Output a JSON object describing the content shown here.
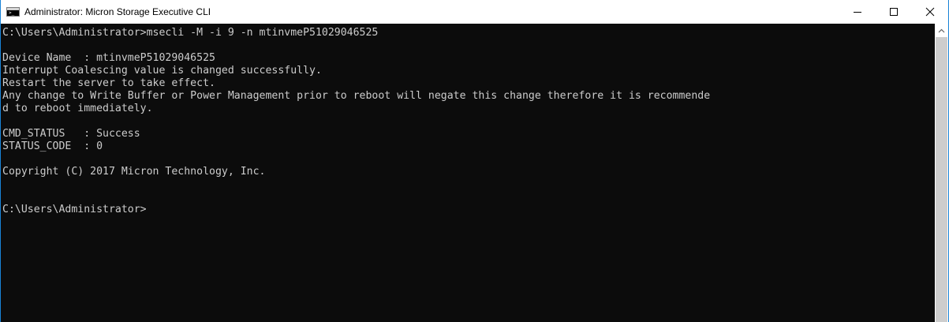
{
  "window": {
    "title": "Administrator: Micron Storage Executive CLI",
    "app_icon_text": ">_"
  },
  "titlebar_buttons": [
    "minimize",
    "maximize",
    "close"
  ],
  "console": {
    "lines": [
      "C:\\Users\\Administrator>msecli -M -i 9 -n mtinvmeP51029046525",
      "",
      "Device Name  : mtinvmeP51029046525",
      "Interrupt Coalescing value is changed successfully.",
      "Restart the server to take effect.",
      "Any change to Write Buffer or Power Management prior to reboot will negate this change therefore it is recommende",
      "d to reboot immediately.",
      "",
      "CMD_STATUS   : Success",
      "STATUS_CODE  : 0",
      "",
      "Copyright (C) 2017 Micron Technology, Inc.",
      "",
      "",
      "C:\\Users\\Administrator>"
    ]
  },
  "colors": {
    "console_background": "#0c0c0c",
    "console_text": "#cccccc",
    "titlebar_background": "#ffffff",
    "window_border": "#1883d7"
  }
}
